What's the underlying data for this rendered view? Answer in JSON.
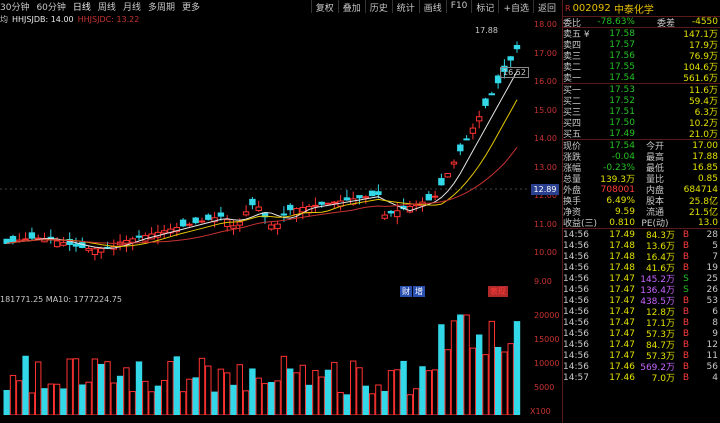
{
  "toolbar": {
    "periods": [
      "30分钟",
      "60分钟",
      "日线",
      "周线",
      "月线",
      "多周期",
      "更多"
    ],
    "active_period": "日线",
    "tools": [
      "复权",
      "叠加",
      "历史",
      "统计",
      "画线",
      "F10",
      "标记",
      "+自选",
      "返回"
    ]
  },
  "ma_legend": {
    "prefix": "均",
    "items": [
      {
        "label": "HHJSJDB: 14.00",
        "color": "#e6e6e6"
      },
      {
        "label": "HHJSJDC: 13.22",
        "color": "#c83232"
      }
    ]
  },
  "price_axis": {
    "ticks": [
      "18.00",
      "17.00",
      "16.00",
      "15.00",
      "14.00",
      "13.00",
      "12.00",
      "11.00",
      "10.00",
      "9.00"
    ],
    "current": "12.89"
  },
  "vol_axis": {
    "ticks": [
      "20000",
      "15000",
      "10000",
      "5000"
    ],
    "multiplier": "X100"
  },
  "vol_legend": "181771.25  MA10: 1777224.75",
  "annotations": {
    "high": "17.88",
    "low": "16.52",
    "events": [
      {
        "label": "财",
        "type": "blue"
      },
      {
        "label": "增",
        "type": "blue"
      },
      {
        "label": "表现",
        "type": "red"
      }
    ]
  },
  "colors": {
    "up": "#ff3232",
    "down": "#32d8e8",
    "ma_white": "#e6e6e6",
    "ma_yellow": "#e6c800",
    "ma_red": "#c83232",
    "accent": "#2b3f8f"
  },
  "stock": {
    "code": "002092",
    "name": "中泰化学",
    "mark": "R"
  },
  "ratio": {
    "label1": "委比",
    "value1": "-78.63%",
    "label2": "委差",
    "value2": "-4550"
  },
  "asks": [
    {
      "label": "卖五 ¥",
      "price": "17.58",
      "vol": "147.1万"
    },
    {
      "label": "卖四",
      "price": "17.57",
      "vol": "17.9万"
    },
    {
      "label": "卖三",
      "price": "17.56",
      "vol": "76.9万"
    },
    {
      "label": "卖二",
      "price": "17.55",
      "vol": "104.6万"
    },
    {
      "label": "卖一",
      "price": "17.54",
      "vol": "561.6万"
    }
  ],
  "bids": [
    {
      "label": "买一",
      "price": "17.53",
      "vol": "11.6万"
    },
    {
      "label": "买二",
      "price": "17.52",
      "vol": "59.4万"
    },
    {
      "label": "买三",
      "price": "17.51",
      "vol": "6.3万"
    },
    {
      "label": "买四",
      "price": "17.50",
      "vol": "10.2万"
    },
    {
      "label": "买五",
      "price": "17.49",
      "vol": "21.0万"
    }
  ],
  "stats": [
    {
      "l1": "现价",
      "v1": "17.54",
      "c1": "green",
      "l2": "今开",
      "v2": "17.00",
      "c2": "yellow"
    },
    {
      "l1": "涨跌",
      "v1": "-0.04",
      "c1": "green",
      "l2": "最高",
      "v2": "17.88",
      "c2": "red"
    },
    {
      "l1": "涨幅",
      "v1": "-0.23%",
      "c1": "green",
      "l2": "最低",
      "v2": "16.85",
      "c2": "yellow"
    },
    {
      "l1": "总量",
      "v1": "139.3万",
      "c1": "yellow",
      "l2": "量比",
      "v2": "0.85",
      "c2": "yellow"
    },
    {
      "l1": "外盘",
      "v1": "708001",
      "c1": "red",
      "l2": "内盘",
      "v2": "684714",
      "c2": "green"
    },
    {
      "l1": "换手",
      "v1": "6.49%",
      "c1": "yellow",
      "l2": "股本",
      "v2": "25.8亿",
      "c2": "yellow"
    },
    {
      "l1": "净资",
      "v1": "9.59",
      "c1": "yellow",
      "l2": "流通",
      "v2": "21.5亿",
      "c2": "yellow"
    },
    {
      "l1": "收益(三)",
      "v1": "0.810",
      "c1": "yellow",
      "l2": "PE(动)",
      "v2": "13.0",
      "c2": "yellow"
    }
  ],
  "ticks": [
    {
      "t": "14:56",
      "p": "17.49",
      "pc": "yellow",
      "v": "84.3万",
      "vc": "yellow",
      "s": "B",
      "sc": "red",
      "n": "28"
    },
    {
      "t": "14:56",
      "p": "17.48",
      "pc": "yellow",
      "v": "13.6万",
      "vc": "yellow",
      "s": "B",
      "sc": "red",
      "n": "5"
    },
    {
      "t": "14:56",
      "p": "17.48",
      "pc": "yellow",
      "v": "16.4万",
      "vc": "yellow",
      "s": "B",
      "sc": "red",
      "n": "7"
    },
    {
      "t": "14:56",
      "p": "17.48",
      "pc": "yellow",
      "v": "41.6万",
      "vc": "yellow",
      "s": "B",
      "sc": "red",
      "n": "19"
    },
    {
      "t": "14:56",
      "p": "17.47",
      "pc": "yellow",
      "v": "145.2万",
      "vc": "purple",
      "s": "S",
      "sc": "green",
      "n": "25"
    },
    {
      "t": "14:56",
      "p": "17.47",
      "pc": "yellow",
      "v": "136.4万",
      "vc": "purple",
      "s": "S",
      "sc": "green",
      "n": "26"
    },
    {
      "t": "14:56",
      "p": "17.47",
      "pc": "yellow",
      "v": "438.5万",
      "vc": "purple",
      "s": "B",
      "sc": "red",
      "n": "53"
    },
    {
      "t": "14:56",
      "p": "17.47",
      "pc": "yellow",
      "v": "12.8万",
      "vc": "yellow",
      "s": "B",
      "sc": "red",
      "n": "6"
    },
    {
      "t": "14:56",
      "p": "17.47",
      "pc": "yellow",
      "v": "17.1万",
      "vc": "yellow",
      "s": "B",
      "sc": "red",
      "n": "8"
    },
    {
      "t": "14:56",
      "p": "17.47",
      "pc": "yellow",
      "v": "57.3万",
      "vc": "yellow",
      "s": "B",
      "sc": "red",
      "n": "9"
    },
    {
      "t": "14:56",
      "p": "17.47",
      "pc": "yellow",
      "v": "84.7万",
      "vc": "yellow",
      "s": "B",
      "sc": "red",
      "n": "12"
    },
    {
      "t": "14:56",
      "p": "17.47",
      "pc": "yellow",
      "v": "57.3万",
      "vc": "yellow",
      "s": "B",
      "sc": "red",
      "n": "11"
    },
    {
      "t": "14:56",
      "p": "17.46",
      "pc": "yellow",
      "v": "569.2万",
      "vc": "purple",
      "s": "B",
      "sc": "red",
      "n": "56"
    },
    {
      "t": "14:57",
      "p": "17.46",
      "pc": "yellow",
      "v": "7.0万",
      "vc": "yellow",
      "s": "B",
      "sc": "red",
      "n": "4"
    }
  ]
}
